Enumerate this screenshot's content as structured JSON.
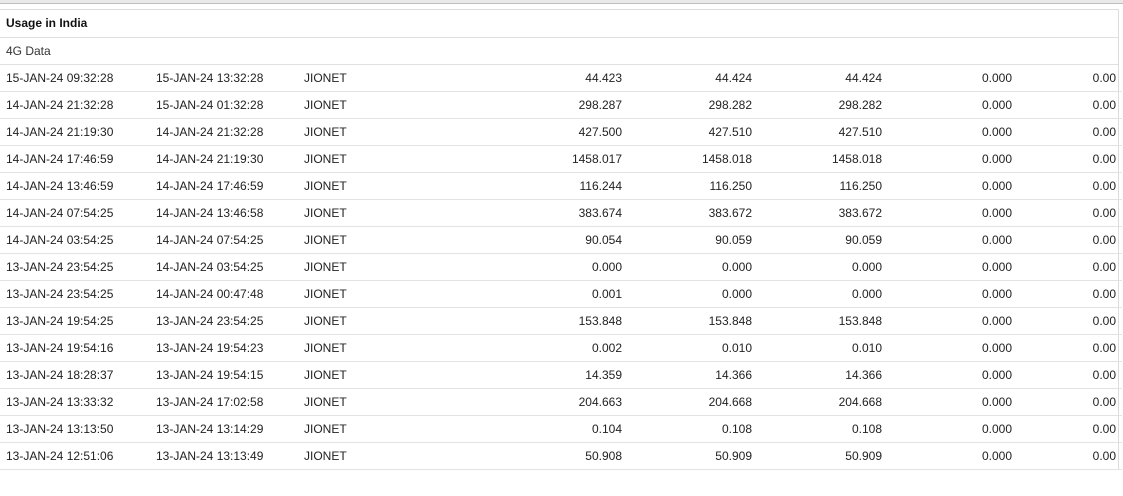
{
  "section": {
    "title": "Usage in India",
    "subtitle": "4G Data"
  },
  "rows": [
    {
      "start": "15-JAN-24 09:32:28",
      "end": "15-JAN-24 13:32:28",
      "apn": "JIONET",
      "v1": "44.423",
      "v2": "44.424",
      "v3": "44.424",
      "v4": "0.000",
      "v5": "0.00"
    },
    {
      "start": "14-JAN-24 21:32:28",
      "end": "15-JAN-24 01:32:28",
      "apn": "JIONET",
      "v1": "298.287",
      "v2": "298.282",
      "v3": "298.282",
      "v4": "0.000",
      "v5": "0.00"
    },
    {
      "start": "14-JAN-24 21:19:30",
      "end": "14-JAN-24 21:32:28",
      "apn": "JIONET",
      "v1": "427.500",
      "v2": "427.510",
      "v3": "427.510",
      "v4": "0.000",
      "v5": "0.00"
    },
    {
      "start": "14-JAN-24 17:46:59",
      "end": "14-JAN-24 21:19:30",
      "apn": "JIONET",
      "v1": "1458.017",
      "v2": "1458.018",
      "v3": "1458.018",
      "v4": "0.000",
      "v5": "0.00"
    },
    {
      "start": "14-JAN-24 13:46:59",
      "end": "14-JAN-24 17:46:59",
      "apn": "JIONET",
      "v1": "116.244",
      "v2": "116.250",
      "v3": "116.250",
      "v4": "0.000",
      "v5": "0.00"
    },
    {
      "start": "14-JAN-24 07:54:25",
      "end": "14-JAN-24 13:46:58",
      "apn": "JIONET",
      "v1": "383.674",
      "v2": "383.672",
      "v3": "383.672",
      "v4": "0.000",
      "v5": "0.00"
    },
    {
      "start": "14-JAN-24 03:54:25",
      "end": "14-JAN-24 07:54:25",
      "apn": "JIONET",
      "v1": "90.054",
      "v2": "90.059",
      "v3": "90.059",
      "v4": "0.000",
      "v5": "0.00"
    },
    {
      "start": "13-JAN-24 23:54:25",
      "end": "14-JAN-24 03:54:25",
      "apn": "JIONET",
      "v1": "0.000",
      "v2": "0.000",
      "v3": "0.000",
      "v4": "0.000",
      "v5": "0.00"
    },
    {
      "start": "13-JAN-24 23:54:25",
      "end": "14-JAN-24 00:47:48",
      "apn": "JIONET",
      "v1": "0.001",
      "v2": "0.000",
      "v3": "0.000",
      "v4": "0.000",
      "v5": "0.00"
    },
    {
      "start": "13-JAN-24 19:54:25",
      "end": "13-JAN-24 23:54:25",
      "apn": "JIONET",
      "v1": "153.848",
      "v2": "153.848",
      "v3": "153.848",
      "v4": "0.000",
      "v5": "0.00"
    },
    {
      "start": "13-JAN-24 19:54:16",
      "end": "13-JAN-24 19:54:23",
      "apn": "JIONET",
      "v1": "0.002",
      "v2": "0.010",
      "v3": "0.010",
      "v4": "0.000",
      "v5": "0.00"
    },
    {
      "start": "13-JAN-24 18:28:37",
      "end": "13-JAN-24 19:54:15",
      "apn": "JIONET",
      "v1": "14.359",
      "v2": "14.366",
      "v3": "14.366",
      "v4": "0.000",
      "v5": "0.00"
    },
    {
      "start": "13-JAN-24 13:33:32",
      "end": "13-JAN-24 17:02:58",
      "apn": "JIONET",
      "v1": "204.663",
      "v2": "204.668",
      "v3": "204.668",
      "v4": "0.000",
      "v5": "0.00"
    },
    {
      "start": "13-JAN-24 13:13:50",
      "end": "13-JAN-24 13:14:29",
      "apn": "JIONET",
      "v1": "0.104",
      "v2": "0.108",
      "v3": "0.108",
      "v4": "0.000",
      "v5": "0.00"
    },
    {
      "start": "13-JAN-24 12:51:06",
      "end": "13-JAN-24 13:13:49",
      "apn": "JIONET",
      "v1": "50.908",
      "v2": "50.909",
      "v3": "50.909",
      "v4": "0.000",
      "v5": "0.00"
    }
  ]
}
